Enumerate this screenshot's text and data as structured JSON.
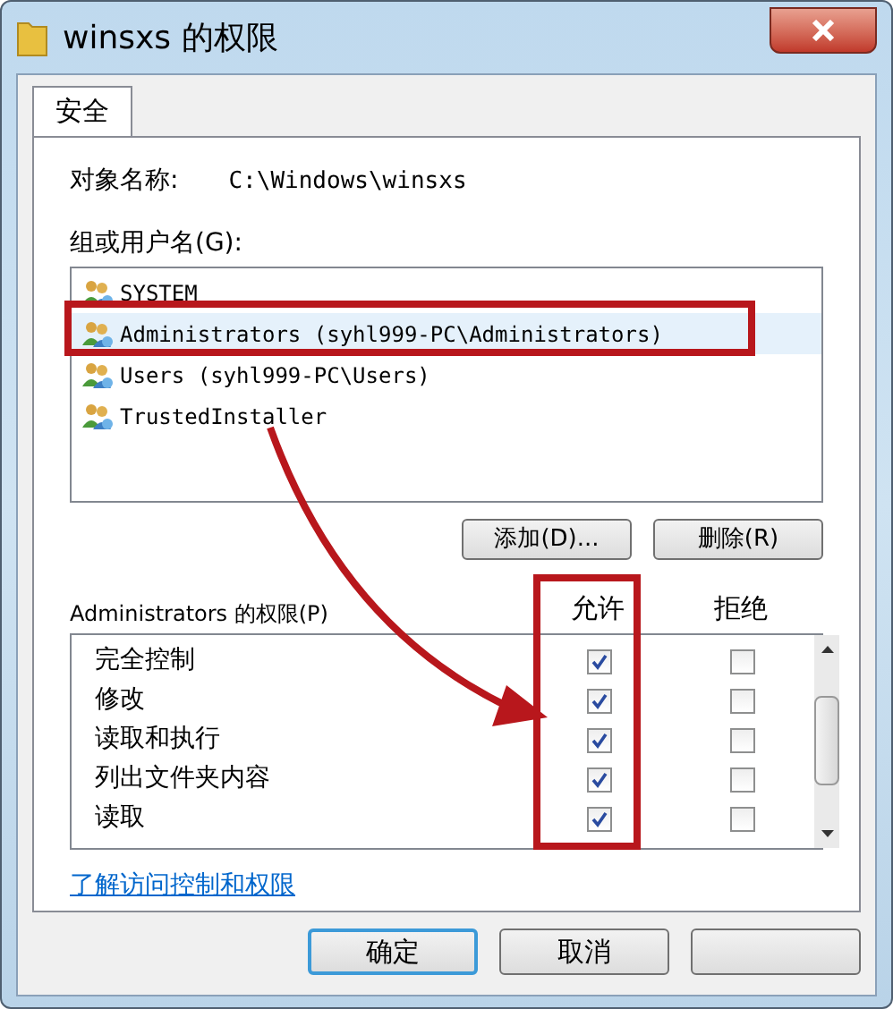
{
  "window": {
    "title": "winsxs 的权限"
  },
  "tabs": [
    {
      "label": "安全",
      "selected": true
    }
  ],
  "object_name": {
    "label": "对象名称:",
    "value": "C:\\Windows\\winsxs"
  },
  "group_list": {
    "label": "组或用户名(G):",
    "items": [
      {
        "name": "SYSTEM",
        "selected": false
      },
      {
        "name": "Administrators (syhl999-PC\\Administrators)",
        "selected": true
      },
      {
        "name": "Users (syhl999-PC\\Users)",
        "selected": false
      },
      {
        "name": "TrustedInstaller",
        "selected": false
      }
    ]
  },
  "list_buttons": [
    "添加(D)...",
    "删除(R)"
  ],
  "permissions": {
    "label": "Administrators 的权限(P)",
    "columns": [
      "允许",
      "拒绝"
    ],
    "rows": [
      {
        "name": "完全控制",
        "allow": true,
        "deny": false
      },
      {
        "name": "修改",
        "allow": true,
        "deny": false
      },
      {
        "name": "读取和执行",
        "allow": true,
        "deny": false
      },
      {
        "name": "列出文件夹内容",
        "allow": true,
        "deny": false
      },
      {
        "name": "读取",
        "allow": true,
        "deny": false
      }
    ]
  },
  "link": "了解访问控制和权限",
  "footer_buttons": [
    {
      "label": "确定",
      "default": true
    },
    {
      "label": "取消",
      "default": false
    },
    {
      "default": false
    }
  ]
}
